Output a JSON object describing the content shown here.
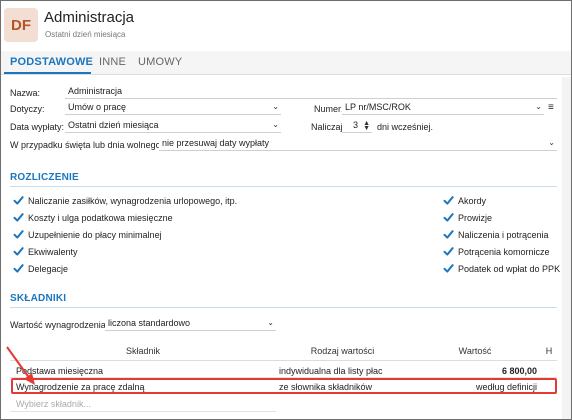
{
  "app": {
    "logo_text": "DF",
    "title": "Administracja",
    "subtitle": "Ostatni dzień miesiąca"
  },
  "tabs": [
    {
      "label": "PODSTAWOWE",
      "active": true
    },
    {
      "label": "INNE",
      "active": false
    },
    {
      "label": "UMOWY",
      "active": false
    }
  ],
  "form": {
    "nazwa_label": "Nazwa:",
    "nazwa_value": "Administracja",
    "dotyczy_label": "Dotyczy:",
    "dotyczy_value": "Umów o pracę",
    "numer_label": "Numer:",
    "numer_value": "LP nr/MSC/ROK",
    "data_wyplaty_label": "Data wypłaty:",
    "data_wyplaty_value": "Ostatni dzień miesiąca",
    "naliczaj_label": "Naliczaj:",
    "naliczaj_value": "3",
    "naliczaj_suffix": "dni wcześniej.",
    "swieta_label": "W przypadku święta lub dnia wolnego:",
    "swieta_value": "nie przesuwaj daty wypłaty"
  },
  "rozliczenie": {
    "title": "ROZLICZENIE",
    "left": [
      "Naliczanie zasiłków, wynagrodzenia urlopowego, itp.",
      "Koszty i ulga podatkowa miesięczne",
      "Uzupełnienie do płacy minimalnej",
      "Ekwiwalenty",
      "Delegacje"
    ],
    "right": [
      "Akordy",
      "Prowizje",
      "Naliczenia i potrącenia",
      "Potrącenia komornicze",
      "Podatek od wpłat do PPK"
    ]
  },
  "skladniki": {
    "title": "SKŁADNIKI",
    "wartosc_label": "Wartość wynagrodzenia:",
    "wartosc_value": "liczona standardowo",
    "columns": [
      "Składnik",
      "Rodzaj wartości",
      "Wartość",
      "H"
    ],
    "rows": [
      {
        "name": "Podstawa miesięczna",
        "type": "indywidualna dla listy płac",
        "value": "6 800,00"
      },
      {
        "name": "Wynagrodzenie za pracę zdalną",
        "type": "ze słownika składników",
        "value": "według definicji"
      }
    ],
    "add_placeholder": "Wybierz składnik..."
  },
  "colors": {
    "accent": "#1b76be",
    "check": "#1b76be",
    "highlight": "#e53935",
    "logo_bg": "#f2ded2",
    "logo_fg": "#b5532a"
  },
  "icons": {
    "chevron": "chevron-down-icon",
    "list": "list-icon",
    "spinner": "spinner-icon",
    "check": "check-icon",
    "arrow": "red-arrow-annotation"
  }
}
